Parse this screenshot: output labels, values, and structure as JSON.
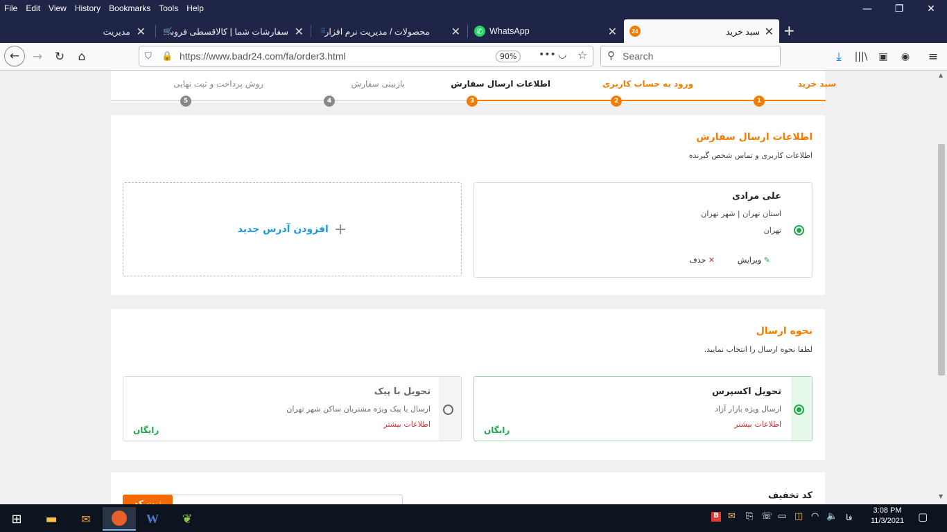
{
  "menu": [
    "File",
    "Edit",
    "View",
    "History",
    "Bookmarks",
    "Tools",
    "Help"
  ],
  "tabs": [
    {
      "title": "سبد خرید",
      "favicon": "24",
      "favicon_color": "#f57c00"
    },
    {
      "title": "WhatsApp",
      "favicon": "whatsapp-icon",
      "favicon_color": "#25d366"
    },
    {
      "title": "محصولات / مدیریت نرم افزار",
      "favicon": "grid-icon",
      "favicon_color": "#4a90d9"
    },
    {
      "title": "سفارشات شما | کالاقسطی فروش",
      "favicon": "cart-icon",
      "favicon_color": "#ddd"
    },
    {
      "title": "مدیریت",
      "favicon": "",
      "favicon_color": ""
    }
  ],
  "url": "https://www.badr24.com/fa/order3.html",
  "zoom": "90%",
  "search_placeholder": "Search",
  "steps": [
    {
      "num": "1",
      "label": "سبد خرید",
      "state": "done"
    },
    {
      "num": "2",
      "label": "ورود به حساب کاربری",
      "state": "done"
    },
    {
      "num": "3",
      "label": "اطلاعات ارسال سفارش",
      "state": "current"
    },
    {
      "num": "4",
      "label": "بازبینی سفارش",
      "state": "todo"
    },
    {
      "num": "5",
      "label": "روش پرداخت و ثبت نهایی",
      "state": "todo"
    }
  ],
  "shipping_info": {
    "title": "اطلاعات ارسال سفارش",
    "subtitle": "اطلاعات کاربری و تماس شخص گیرنده",
    "address": {
      "name": "علی مرادی",
      "province": "استان تهران | شهر تهران",
      "city": "تهران",
      "edit": "ویرایش",
      "delete": "حذف"
    },
    "add_new": "افزودن آدرس جدید"
  },
  "delivery": {
    "title": "نحوه ارسال",
    "subtitle": "لطفا نحوه ارسال را انتخاب نمایید.",
    "options": [
      {
        "title": "تحویل اکسپرس",
        "desc": "ارسال ویژه بازار آزاد",
        "more": "اطلاعات بیشتر",
        "price": "رایگان",
        "selected": true
      },
      {
        "title": "تحویل با پیک",
        "desc": "ارسال با پیک ویژه مشتریان ساکن شهر تهران",
        "more": "اطلاعات بیشتر",
        "price": "رایگان",
        "selected": false
      }
    ]
  },
  "discount": {
    "title": "کد تخفیف",
    "button": "ثبت کد"
  },
  "colors": {
    "accent": "#f57c00",
    "green": "#1aa849",
    "link": "#1a9bd7",
    "red": "#d32f2f"
  },
  "taskbar": {
    "time": "3:08 PM",
    "date": "11/3/2021",
    "lang": "فا"
  }
}
